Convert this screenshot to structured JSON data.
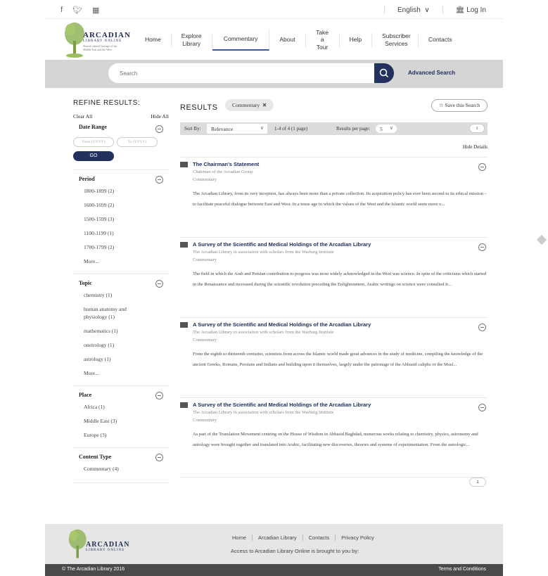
{
  "util": {
    "language": "English",
    "login": "Log In"
  },
  "logo": {
    "name": "ARCADIAN",
    "sub": "LIBRARY ONLINE",
    "tagline": "Shared cultural heritage of the Middle East and the West"
  },
  "nav": [
    {
      "label": "Home"
    },
    {
      "label": "Explore Library"
    },
    {
      "label": "Commentary"
    },
    {
      "label": "About"
    },
    {
      "label": "Take a Tour"
    },
    {
      "label": "Help"
    },
    {
      "label": "Subscriber Services"
    },
    {
      "label": "Contacts"
    }
  ],
  "search": {
    "placeholder": "Search",
    "advanced": "Advanced Search"
  },
  "sidebar": {
    "title": "REFINE RESULTS:",
    "clear_all": "Clear All",
    "hide_all": "Hide All",
    "date_range": {
      "title": "Date Range",
      "from": "From (YYYY)",
      "to": "To (YYYY)",
      "go": "GO"
    },
    "period": {
      "title": "Period",
      "items": [
        "1800-1899 (2)",
        "1600-1699 (2)",
        "1500-1599 (3)",
        "1100-1199 (1)",
        "1700-1799 (2)",
        "More..."
      ]
    },
    "topic": {
      "title": "Topic",
      "items": [
        "chemistry (1)",
        "human anatomy and physiology (1)",
        "mathematics (1)",
        "oneirology (1)",
        "astrology (1)",
        "More..."
      ]
    },
    "place": {
      "title": "Place",
      "items": [
        "Africa (1)",
        "Middle East (3)",
        "Europe (3)"
      ]
    },
    "content_type": {
      "title": "Content Type",
      "items": [
        "Commentary (4)"
      ]
    }
  },
  "results": {
    "title": "RESULTS",
    "chip": "Commentary",
    "save": "Save this Search",
    "sort_by": "Sort By:",
    "sort_value": "Relevance",
    "range": "1-4 of 4 (1 page)",
    "per_page_label": "Results per page:",
    "per_page": "5",
    "page": "1",
    "hide_details": "Hide Details",
    "items": [
      {
        "title": "The Chairman's Statement",
        "meta": "Chairman of the Arcadian Group",
        "type": "Commentary",
        "desc": "The Arcadian Library, from its very inception, has always been more than a private collection. Its acquisition policy has ever been second to its ethical mission – to facilitate peaceful dialogue between East and West. In a tense age in which the values of the West and the Islamic world seem more o..."
      },
      {
        "title": "A Survey of the Scientific and Medical Holdings of the Arcadian Library",
        "meta": "The Arcadian Library in association with scholars from the Warburg Institute",
        "type": "Commentary",
        "desc": "The field in which the Arab and Persian contribution to progress was most widely acknowledged in the West was science. In spite of the criticisms which started in the Renaissance and increased during the scientific revolution preceding the Enlightenment, Arabic writings on science were consulted fr..."
      },
      {
        "title": "A Survey of the Scientific and Medical Holdings of the Arcadian Library",
        "meta": "The Arcadian Library in association with scholars from the Warburg Institute",
        "type": "Commentary",
        "desc": "From the eighth to thirteenth centuries, scientists from across the Islamic world made great advances in the study of medicine, compiling the knowledge of the ancient Greeks, Romans, Persians and Indians and building upon it themselves, largely under the patronage of the Abbasid caliphs or the Musl..."
      },
      {
        "title": "A Survey of the Scientific and Medical Holdings of the Arcadian Library",
        "meta": "The Arcadian Library in association with scholars from the Warburg Institute",
        "type": "Commentary",
        "desc": "As part of the Translation Movement centring on the House of Wisdom in Abbasid Baghdad, numerous works relating to chemistry, physics, astronomy and astrology were brought together and translated into Arabic, facilitating new discoveries, theories and systems of experimentation. From the astrologic..."
      }
    ]
  },
  "footer": {
    "links": [
      "Home",
      "Arcadian Library",
      "Contacts",
      "Privacy Policy"
    ],
    "access": "Access to Arcadian Library Online is brought to you by:",
    "copyright": "© The Arcadian Library 2016",
    "terms": "Terms and Conditions"
  },
  "colors": {
    "brand_navy": "#22315e",
    "search_band": "#d5d5d5",
    "footer": "#e6e6e6",
    "copy_bar": "#4a4a4a"
  }
}
